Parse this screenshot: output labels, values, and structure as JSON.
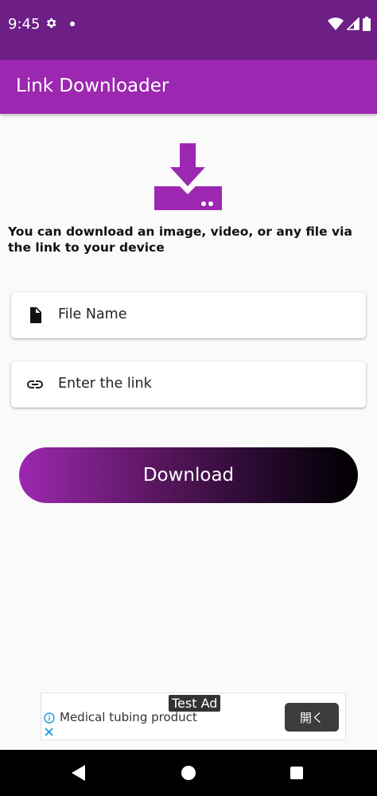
{
  "status_bar": {
    "time": "9:45",
    "icons": [
      "gear-icon",
      "notification-dot",
      "wifi-icon",
      "signal-icon",
      "battery-icon"
    ]
  },
  "app_bar": {
    "title": "Link Downloader",
    "color": "#9c27b0"
  },
  "hero": {
    "icon": "download-to-drive-icon",
    "color": "#9c27b0"
  },
  "description": "You can download an image, video, or any file via the link to your device",
  "form": {
    "file_name": {
      "icon": "file-icon",
      "placeholder": "File Name"
    },
    "link": {
      "icon": "link-icon",
      "placeholder": "Enter the link"
    }
  },
  "download_button": {
    "label": "Download",
    "gradient": [
      "#9c27b0",
      "#000000"
    ]
  },
  "ad": {
    "badge": "Test Ad",
    "text": "Medical tubing product",
    "open_label": "開く",
    "icons": [
      "info-icon",
      "close-icon"
    ]
  },
  "nav_bar": {
    "icons": [
      "back-icon",
      "home-icon",
      "recents-icon"
    ]
  }
}
